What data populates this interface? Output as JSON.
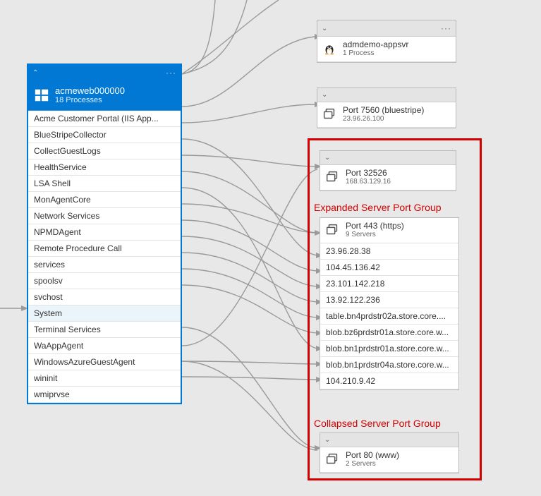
{
  "main": {
    "name": "acmeweb000000",
    "sub": "18 Processes",
    "processes": [
      "Acme Customer Portal (IIS App...",
      "BlueStripeCollector",
      "CollectGuestLogs",
      "HealthService",
      "LSA Shell",
      "MonAgentCore",
      "Network Services",
      "NPMDAgent",
      "Remote Procedure Call",
      "services",
      "spoolsv",
      "svchost",
      "System",
      "Terminal Services",
      "WaAppAgent",
      "WindowsAzureGuestAgent",
      "wininit",
      "wmiprvse"
    ],
    "selected_index": 12
  },
  "node_appsvr": {
    "name": "admdemo-appsvr",
    "sub": "1 Process"
  },
  "node_7560": {
    "name": "Port 7560 (bluestripe)",
    "sub": "23.96.26.100"
  },
  "node_32526": {
    "name": "Port 32526",
    "sub": "168.63.129.16"
  },
  "node_443": {
    "name": "Port 443 (https)",
    "sub": "9 Servers",
    "servers": [
      "23.96.28.38",
      "104.45.136.42",
      "23.101.142.218",
      "13.92.122.236",
      "table.bn4prdstr02a.store.core....",
      "blob.bz6prdstr01a.store.core.w...",
      "blob.bn1prdstr01a.store.core.w...",
      "blob.bn1prdstr04a.store.core.w...",
      "104.210.9.42"
    ]
  },
  "node_80": {
    "name": "Port 80 (www)",
    "sub": "2 Servers"
  },
  "annotations": {
    "expanded": "Expanded Server Port Group",
    "collapsed": "Collapsed Server Port Group"
  }
}
